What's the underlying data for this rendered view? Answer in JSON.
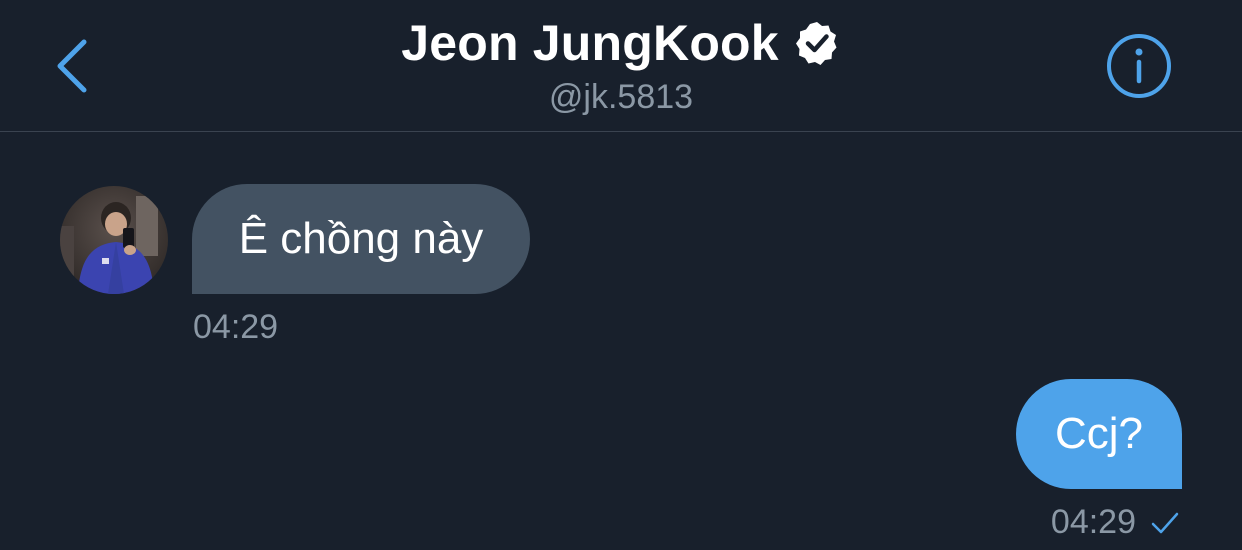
{
  "header": {
    "title": "Jeon JungKook",
    "handle": "@jk.5813",
    "back_icon": "chevron-left-icon",
    "info_icon": "info-icon",
    "verified_icon": "verified-badge-icon"
  },
  "messages": [
    {
      "direction": "incoming",
      "text": "Ê chồng này",
      "time": "04:29"
    },
    {
      "direction": "outgoing",
      "text": "Ccj?",
      "time": "04:29",
      "status_icon": "checkmark-icon"
    }
  ],
  "colors": {
    "background": "#18202c",
    "accent": "#4ea3ea",
    "incoming_bubble": "#435262",
    "secondary_text": "#8b98a5"
  }
}
